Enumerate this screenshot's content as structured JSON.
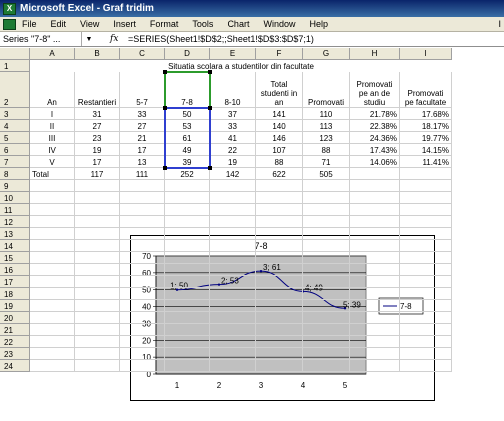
{
  "app": {
    "title": "Microsoft Excel - Graf tridim",
    "icon_label": "X"
  },
  "menu": [
    "File",
    "Edit",
    "View",
    "Insert",
    "Format",
    "Tools",
    "Chart",
    "Window",
    "Help"
  ],
  "menu_trailing": "I",
  "formula_bar": {
    "name_box": "Series \"7-8\" ...",
    "fx": "fx",
    "formula": "=SERIES(Sheet1!$D$2;;Sheet1!$D$3:$D$7;1)"
  },
  "columns": [
    "A",
    "B",
    "C",
    "D",
    "E",
    "F",
    "G",
    "H",
    "I"
  ],
  "rows": [
    "1",
    "2",
    "3",
    "4",
    "5",
    "6",
    "7",
    "8",
    "9",
    "10",
    "11",
    "12",
    "13",
    "14",
    "15",
    "16",
    "17",
    "18",
    "19",
    "20",
    "21",
    "22",
    "23",
    "24"
  ],
  "sheet": {
    "title": "Situatia scolara a studentilor din facultate",
    "headers": [
      "An",
      "Restantieri",
      "5-7",
      "7-8",
      "8-10",
      "Total studenti in an",
      "Promovati",
      "Promovati pe an de studiu",
      "Promovati pe facultate"
    ],
    "data": [
      [
        "I",
        "31",
        "33",
        "50",
        "37",
        "141",
        "110",
        "21.78%",
        "17.68%"
      ],
      [
        "II",
        "27",
        "27",
        "53",
        "33",
        "140",
        "113",
        "22.38%",
        "18.17%"
      ],
      [
        "III",
        "23",
        "21",
        "61",
        "41",
        "146",
        "123",
        "24.36%",
        "19.77%"
      ],
      [
        "IV",
        "19",
        "17",
        "49",
        "22",
        "107",
        "88",
        "17.43%",
        "14.15%"
      ],
      [
        "V",
        "17",
        "13",
        "39",
        "19",
        "88",
        "71",
        "14.06%",
        "11.41%"
      ],
      [
        "Total",
        "117",
        "111",
        "252",
        "142",
        "622",
        "505",
        "",
        ""
      ]
    ]
  },
  "chart_data": {
    "type": "line",
    "title": "7-8",
    "categories": [
      "1",
      "2",
      "3",
      "4",
      "5"
    ],
    "series": [
      {
        "name": "7-8",
        "values": [
          50,
          53,
          61,
          49,
          39
        ]
      }
    ],
    "data_labels": [
      "1; 50",
      "2; 53",
      "3; 61",
      "4; 49",
      "5; 39"
    ],
    "yticks": [
      "0",
      "10",
      "20",
      "30",
      "40",
      "50",
      "60",
      "70"
    ],
    "ylim": [
      0,
      70
    ],
    "grid": true,
    "legend": "right",
    "colors": {
      "line": "#000080",
      "plot_bg": "#c0c0c0"
    }
  }
}
